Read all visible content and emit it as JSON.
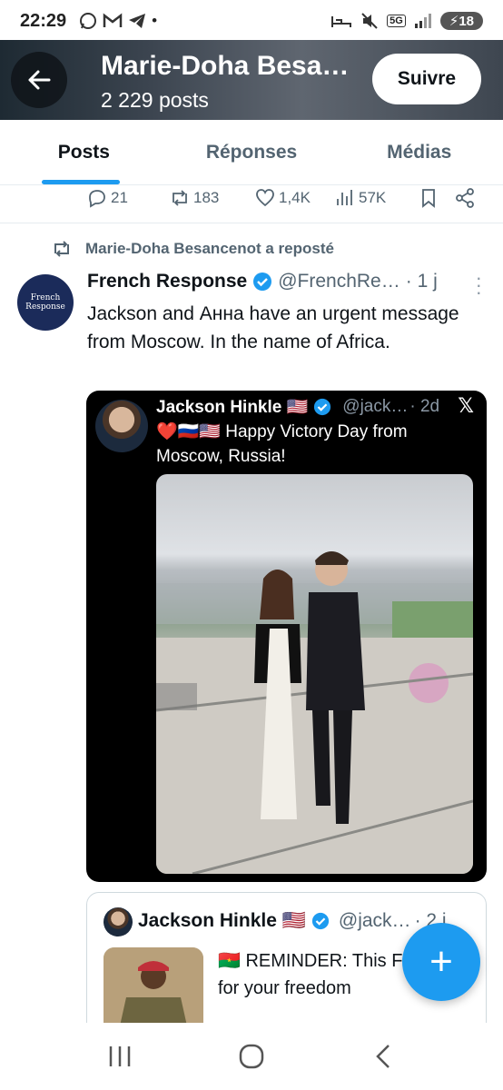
{
  "status_bar": {
    "time": "22:29",
    "app_icons": [
      "whatsapp-icon",
      "gmail-icon",
      "telegram-icon"
    ],
    "dot": "•",
    "network": "5G",
    "battery": "18"
  },
  "header": {
    "title": "Marie-Doha Besa…",
    "posts_count": "2 229 posts",
    "follow_label": "Suivre"
  },
  "tabs": [
    {
      "label": "Posts",
      "active": true
    },
    {
      "label": "Réponses",
      "active": false
    },
    {
      "label": "Médias",
      "active": false
    }
  ],
  "previous_tweet_actions": {
    "replies": "21",
    "reposts": "183",
    "likes": "1,4K",
    "views": "57K"
  },
  "retweet_context": "Marie-Doha Besancenot a reposté",
  "tweet": {
    "avatar_text": [
      "French",
      "Response"
    ],
    "author_name": "French Response",
    "author_handle": "@FrenchRe…",
    "time": "· 1 j",
    "text": "Jackson and Анна have an urgent message from Moscow. In the name of Africa."
  },
  "embed": {
    "author_name": "Jackson Hinkle 🇺🇸",
    "author_handle": "@jack…",
    "time": "· 2d",
    "x_logo": "𝕏",
    "text": "❤️🇷🇺🇺🇸 Happy Victory Day from Moscow, Russia!"
  },
  "quote": {
    "author_name": "Jackson Hinkle 🇺🇸",
    "author_handle": "@jack…",
    "time": "· 2 j",
    "text": "🇧🇫 REMINDER: This FIGHTS for your freedom"
  },
  "fab_label": "+",
  "colors": {
    "accent": "#1d9bf0",
    "text": "#0f1419",
    "secondary": "#536471"
  }
}
